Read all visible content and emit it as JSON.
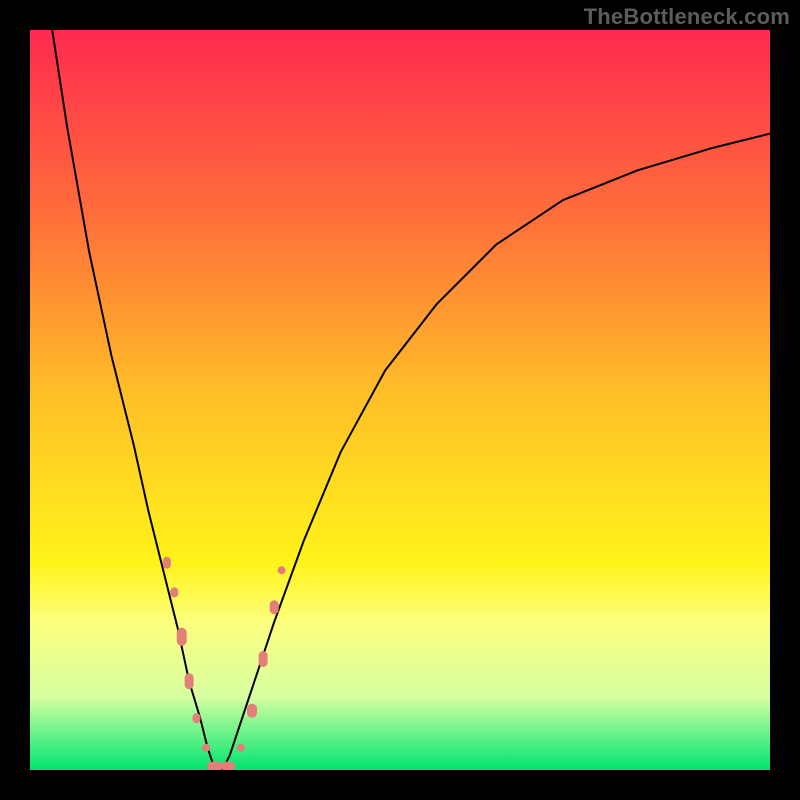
{
  "watermark": "TheBottleneck.com",
  "chart_data": {
    "type": "line",
    "title": "",
    "xlabel": "",
    "ylabel": "",
    "xlim": [
      0,
      100
    ],
    "ylim": [
      0,
      100
    ],
    "background": {
      "type": "vertical_gradient",
      "stops": [
        {
          "offset": 0.0,
          "color": "#ff2a4f"
        },
        {
          "offset": 0.25,
          "color": "#ff6e3a"
        },
        {
          "offset": 0.5,
          "color": "#ffc127"
        },
        {
          "offset": 0.72,
          "color": "#fff31a"
        },
        {
          "offset": 0.8,
          "color": "#fdff7d"
        },
        {
          "offset": 0.9,
          "color": "#d8ffa0"
        },
        {
          "offset": 0.95,
          "color": "#6bf38a"
        },
        {
          "offset": 1.0,
          "color": "#00e46f"
        }
      ]
    },
    "series": [
      {
        "name": "bottleneck_curve",
        "style": {
          "stroke": "#000000",
          "width": 2,
          "fill": "none"
        },
        "x": [
          3,
          5,
          8,
          11,
          14,
          16,
          18,
          20,
          21.5,
          23,
          24,
          25,
          26,
          27,
          28,
          30,
          33,
          37,
          42,
          48,
          55,
          63,
          72,
          82,
          92,
          100
        ],
        "y": [
          100,
          87,
          70,
          56,
          44,
          35,
          27,
          19,
          12,
          7,
          3,
          0,
          0,
          2,
          5,
          11,
          20,
          31,
          43,
          54,
          63,
          71,
          77,
          81,
          84,
          86
        ]
      },
      {
        "name": "data_markers",
        "style": {
          "marker_color": "#e37e78",
          "marker_shape": "rounded",
          "marker_size_min": 8,
          "marker_size_max": 18
        },
        "points": [
          {
            "x": 18.5,
            "y": 28,
            "w": 8,
            "h": 12
          },
          {
            "x": 19.5,
            "y": 24,
            "w": 8,
            "h": 10
          },
          {
            "x": 20.5,
            "y": 18,
            "w": 10,
            "h": 18
          },
          {
            "x": 21.5,
            "y": 12,
            "w": 9,
            "h": 16
          },
          {
            "x": 22.5,
            "y": 7,
            "w": 8,
            "h": 10
          },
          {
            "x": 23.8,
            "y": 3,
            "w": 8,
            "h": 8
          },
          {
            "x": 25.0,
            "y": 0.5,
            "w": 16,
            "h": 9
          },
          {
            "x": 26.8,
            "y": 0.5,
            "w": 14,
            "h": 9
          },
          {
            "x": 28.5,
            "y": 3,
            "w": 8,
            "h": 8
          },
          {
            "x": 30.0,
            "y": 8,
            "w": 10,
            "h": 14
          },
          {
            "x": 31.5,
            "y": 15,
            "w": 9,
            "h": 16
          },
          {
            "x": 33.0,
            "y": 22,
            "w": 9,
            "h": 14
          },
          {
            "x": 34.0,
            "y": 27,
            "w": 8,
            "h": 8
          }
        ]
      }
    ]
  }
}
